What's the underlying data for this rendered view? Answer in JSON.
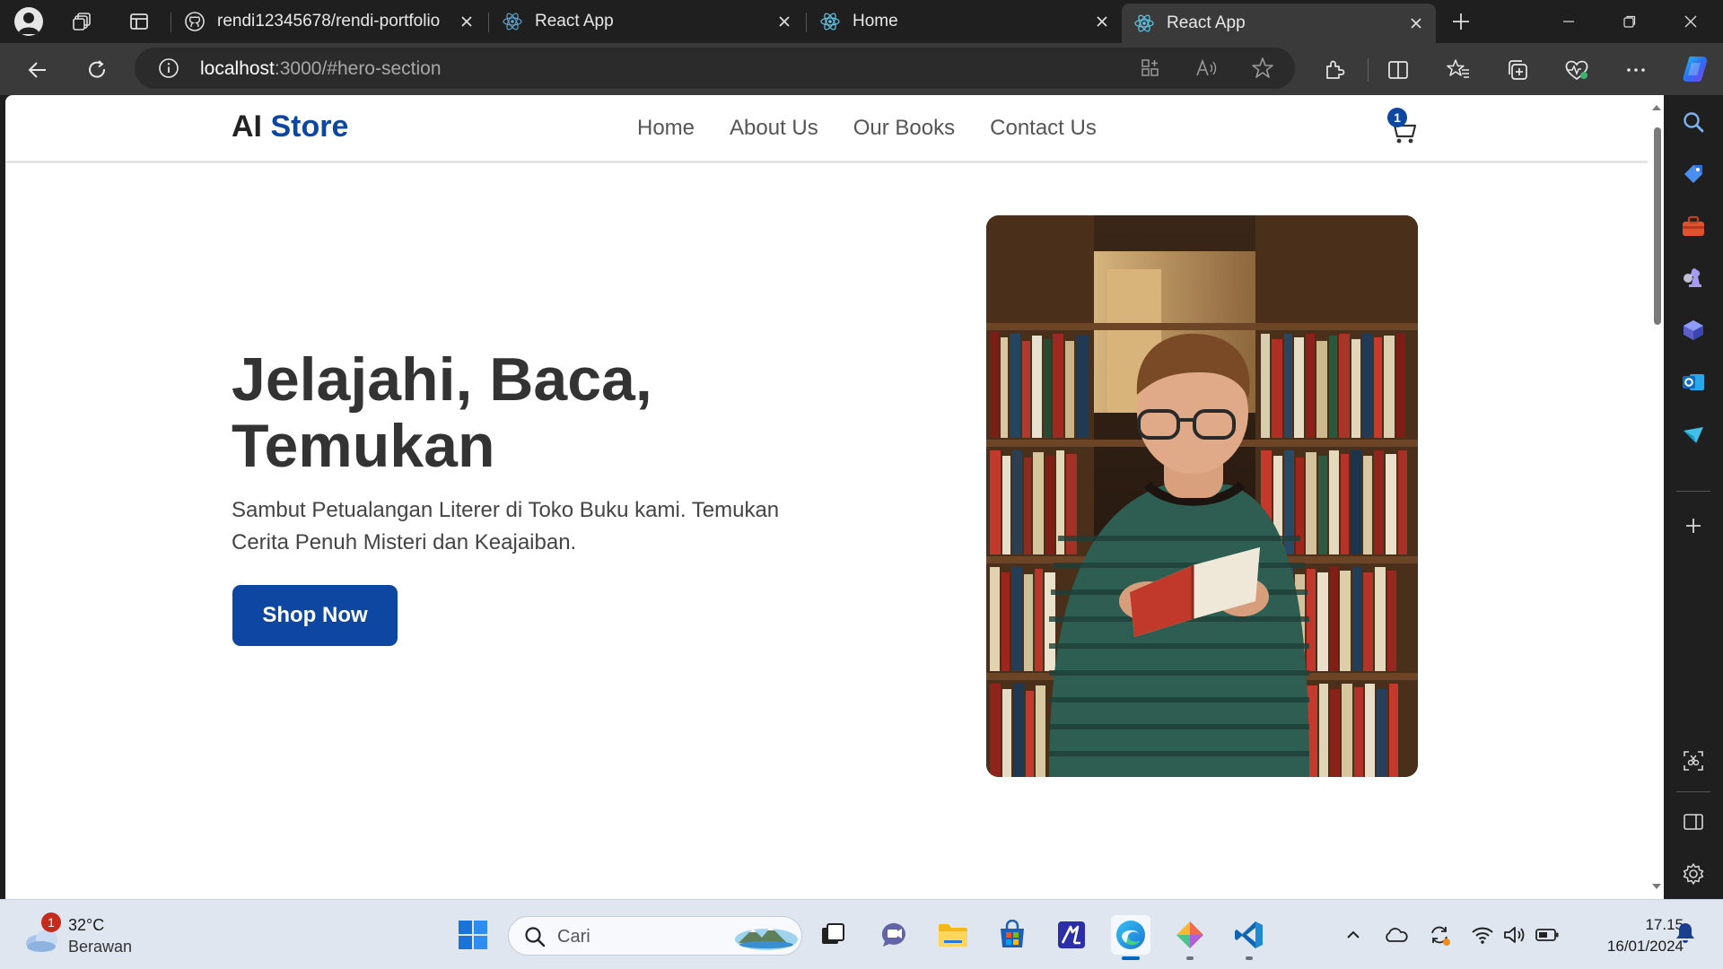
{
  "browser": {
    "tabs": [
      {
        "title": "rendi12345678/rendi-portfolio",
        "icon": "github-icon",
        "active": false
      },
      {
        "title": "React App",
        "icon": "react-icon",
        "active": false
      },
      {
        "title": "Home",
        "icon": "react-icon",
        "active": false
      },
      {
        "title": "React App",
        "icon": "react-icon",
        "active": true
      }
    ],
    "url_host": "localhost",
    "url_rest": ":3000/#hero-section"
  },
  "site": {
    "logo_plain": "AI",
    "logo_accent": "Store",
    "nav": [
      "Home",
      "About Us",
      "Our Books",
      "Contact Us"
    ],
    "cart_count": "1",
    "hero": {
      "title": "Jelajahi, Baca, Temukan",
      "subtitle": "Sambut Petualangan Literer di Toko Buku kami. Temukan Cerita Penuh Misteri dan Keajaiban.",
      "cta": "Shop Now"
    }
  },
  "taskbar": {
    "weather_temp": "32°C",
    "weather_desc": "Berawan",
    "weather_badge": "1",
    "search_placeholder": "Cari",
    "time": "17.15",
    "date": "16/01/2024"
  },
  "colors": {
    "accent": "#0d47a1",
    "browser_dark": "#1f1f1f",
    "taskbar": "#dfe6f0"
  }
}
